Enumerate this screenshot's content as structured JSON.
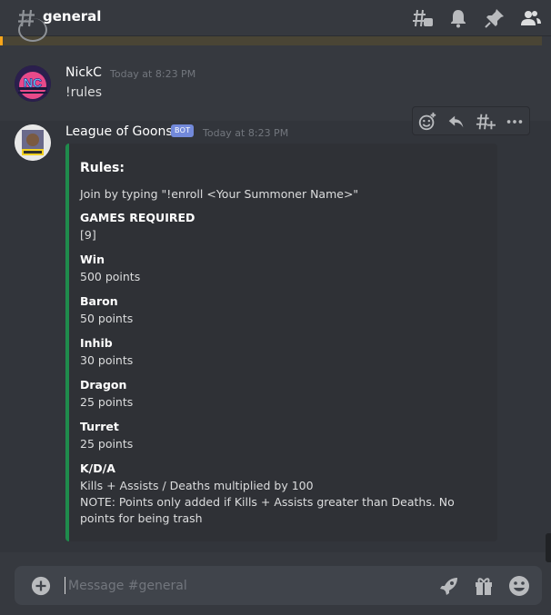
{
  "header": {
    "channel_name": "general",
    "icons": [
      "threads-icon",
      "bell-icon",
      "pin-icon",
      "member-list-icon"
    ]
  },
  "messages": [
    {
      "username": "NickC",
      "username_color": "#ffffff",
      "timestamp": "Today at 8:23 PM",
      "content": "!rules"
    },
    {
      "username": "League of Goons",
      "username_color": "#ffffff",
      "bot_badge": "BOT",
      "timestamp": "Today at 8:23 PM",
      "toolbar_icons": [
        "add-reaction-icon",
        "reply-icon",
        "create-thread-icon",
        "more-icon"
      ],
      "embed": {
        "color": "#1f8b4c",
        "title": "Rules:",
        "description": "Join by typing \"!enroll <Your Summoner Name>\"",
        "fields": [
          {
            "name": "GAMES REQUIRED",
            "value": "[9]"
          },
          {
            "name": "Win",
            "value": "500 points"
          },
          {
            "name": "Baron",
            "value": "50 points"
          },
          {
            "name": "Inhib",
            "value": "30 points"
          },
          {
            "name": "Dragon",
            "value": "25 points"
          },
          {
            "name": "Turret",
            "value": "25 points"
          },
          {
            "name": "K/D/A",
            "value": "Kills + Assists / Deaths multiplied by 100",
            "note": "NOTE: Points only added if Kills + Assists greater than Deaths. No points for being trash"
          }
        ]
      }
    }
  ],
  "composer": {
    "placeholder": "Message #general",
    "icons": [
      "plus-icon",
      "rocket-icon",
      "gift-icon",
      "emoji-icon"
    ]
  },
  "colors": {
    "background": "#36393f",
    "embed_background": "#2f3136",
    "composer_background": "#40444b",
    "bot_badge": "#7289da",
    "mention_bar": "#faa61a"
  }
}
